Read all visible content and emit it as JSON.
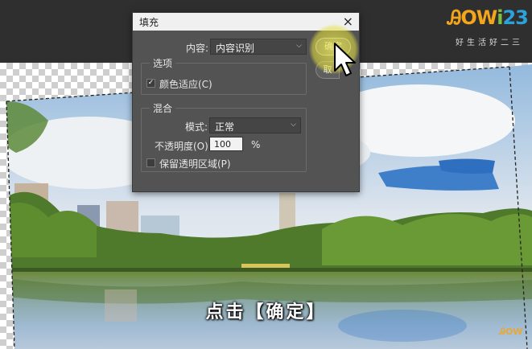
{
  "dialog": {
    "title": "填充",
    "close_glyph": "×",
    "content_label": "内容:",
    "content_value": "内容识别",
    "options_group_title": "选项",
    "color_adapt_label": "颜色适应(C)",
    "color_adapt_checked": true,
    "blend_group_title": "混合",
    "mode_label": "模式:",
    "mode_value": "正常",
    "opacity_label": "不透明度(O):",
    "opacity_value": "100",
    "opacity_unit": "%",
    "preserve_label": "保留透明区域(P)",
    "preserve_checked": false,
    "ok_label": "确定",
    "cancel_label": "取"
  },
  "logo": {
    "text_part1": "ᎯOW",
    "text_part2": "i",
    "text_part3": "23",
    "sub": "好生活好二三"
  },
  "subtitle": "点击【确定】",
  "colors": {
    "dialog_bg": "#535353",
    "highlight": "#e8e43c",
    "logo_orange": "#f3a51c",
    "logo_green": "#7cc242",
    "logo_blue": "#2aa3dd"
  }
}
